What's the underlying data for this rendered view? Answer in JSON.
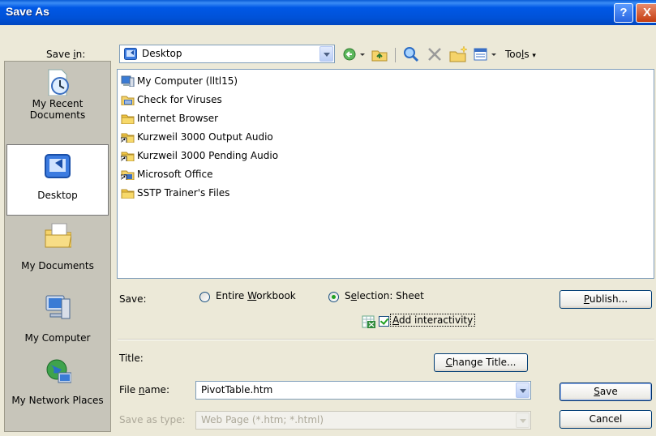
{
  "window": {
    "title": "Save As"
  },
  "title_buttons": {
    "help": "?",
    "close": "X"
  },
  "save_in": {
    "label": "Save in:",
    "value": "Desktop"
  },
  "toolbar": {
    "tools_label": "Tools",
    "tools_underline_char": "l"
  },
  "places": [
    {
      "label": "My Recent Documents",
      "icon": "recent-documents-icon"
    },
    {
      "label": "Desktop",
      "icon": "desktop-icon",
      "selected": true
    },
    {
      "label": "My Documents",
      "icon": "my-documents-icon"
    },
    {
      "label": "My Computer",
      "icon": "my-computer-icon"
    },
    {
      "label": "My Network Places",
      "icon": "network-places-icon"
    }
  ],
  "files": [
    {
      "name": "My Computer (lltl15)",
      "icon": "computer-icon"
    },
    {
      "name": "Check for Viruses",
      "icon": "program-group-icon"
    },
    {
      "name": "Internet Browser",
      "icon": "folder-icon"
    },
    {
      "name": "Kurzweil 3000 Output Audio",
      "icon": "folder-shortcut-icon"
    },
    {
      "name": "Kurzweil 3000 Pending Audio",
      "icon": "folder-shortcut-icon"
    },
    {
      "name": "Microsoft Office",
      "icon": "program-group-shortcut-icon"
    },
    {
      "name": "SSTP Trainer's Files",
      "icon": "folder-icon"
    }
  ],
  "save_options": {
    "label": "Save:",
    "entire_workbook": "Entire Workbook",
    "selection_sheet": "Selection: Sheet",
    "selected": "selection_sheet",
    "add_interactivity": "Add interactivity",
    "add_interactivity_checked": true
  },
  "publish_button": "Publish...",
  "title_field": {
    "label": "Title:",
    "change_button": "Change Title..."
  },
  "file_name": {
    "label": "File name:",
    "value": "PivotTable.htm"
  },
  "save_as_type": {
    "label": "Save as type:",
    "value": "Web Page (*.htm; *.html)"
  },
  "buttons": {
    "save": "Save",
    "cancel": "Cancel"
  },
  "colors": {
    "titlebar": "#0058e6",
    "dialog_bg": "#ece9d8",
    "places_bg": "#c7c5ba",
    "folder": "#f5c842"
  }
}
